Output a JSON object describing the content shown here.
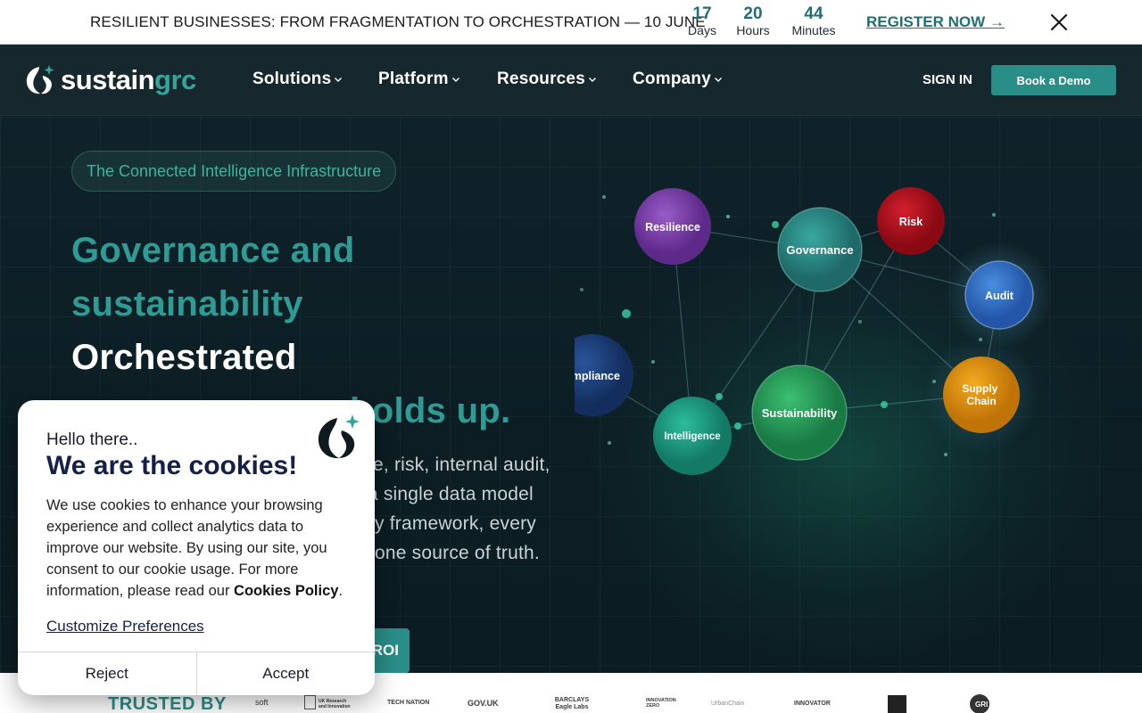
{
  "announcement": {
    "text": "RESILIENT BUSINESSES: FROM FRAGMENTATION TO ORCHESTRATION — 10 JUNE",
    "countdown": [
      {
        "value": "17",
        "unit": "Days"
      },
      {
        "value": "20",
        "unit": "Hours"
      },
      {
        "value": "44",
        "unit": "Minutes"
      }
    ],
    "register_label": "REGISTER NOW →"
  },
  "nav": {
    "logo": {
      "part1": "sustain",
      "part2": "grc"
    },
    "items": [
      "Solutions",
      "Platform",
      "Resources",
      "Company"
    ],
    "sign_in": "SIGN IN",
    "book_demo": "Book a Demo"
  },
  "hero": {
    "pill": "The Connected Intelligence Infrastructure",
    "headline": {
      "line1": "Governance and",
      "line2": "sustainability",
      "line3": "Orchestrated",
      "line4_visible": "holds up."
    },
    "body_lines_visible": [
      "e, risk, internal audit,",
      "n a single data model",
      "y framework, every",
      "one source of truth."
    ],
    "cta_visible": "ROI",
    "network_nodes": [
      {
        "label": "Resilience",
        "color": "#7b3fa8"
      },
      {
        "label": "Governance",
        "color": "#2f8f8a"
      },
      {
        "label": "Risk",
        "color": "#b0121e"
      },
      {
        "label": "Audit",
        "color": "#2f6fc9"
      },
      {
        "label": "ompliance",
        "color": "#1c3d7a"
      },
      {
        "label": "Sustainability",
        "color": "#2aa25f"
      },
      {
        "label": "Intelligence",
        "color": "#1f9c85"
      },
      {
        "label": "Supply Chain",
        "color": "#e0930c"
      }
    ]
  },
  "trusted": {
    "label": "TRUSTED BY",
    "partners": [
      "soft",
      "UK Research and Innovation",
      "TECH NATION",
      "GOV.UK",
      "BARCLAYS Eagle Labs",
      "INNOVATION ZERO",
      "UrbanChain",
      "INNOVATOR",
      "",
      "GRI"
    ]
  },
  "cookie": {
    "hello": "Hello there..",
    "title": "We are the cookies!",
    "body_prefix": "We use cookies to enhance your browsing experience and collect analytics data to improve our website. By using our site, you consent to our cookie usage. For more information, please read our ",
    "body_link": "Cookies Policy",
    "body_suffix": ".",
    "customize": "Customize Preferences",
    "reject": "Reject",
    "accept": "Accept"
  },
  "colors": {
    "accent": "#2a8e88",
    "teal_text": "#2e9c94",
    "nav_bg": "#16272e",
    "hero_bg": "#0d1f26"
  }
}
